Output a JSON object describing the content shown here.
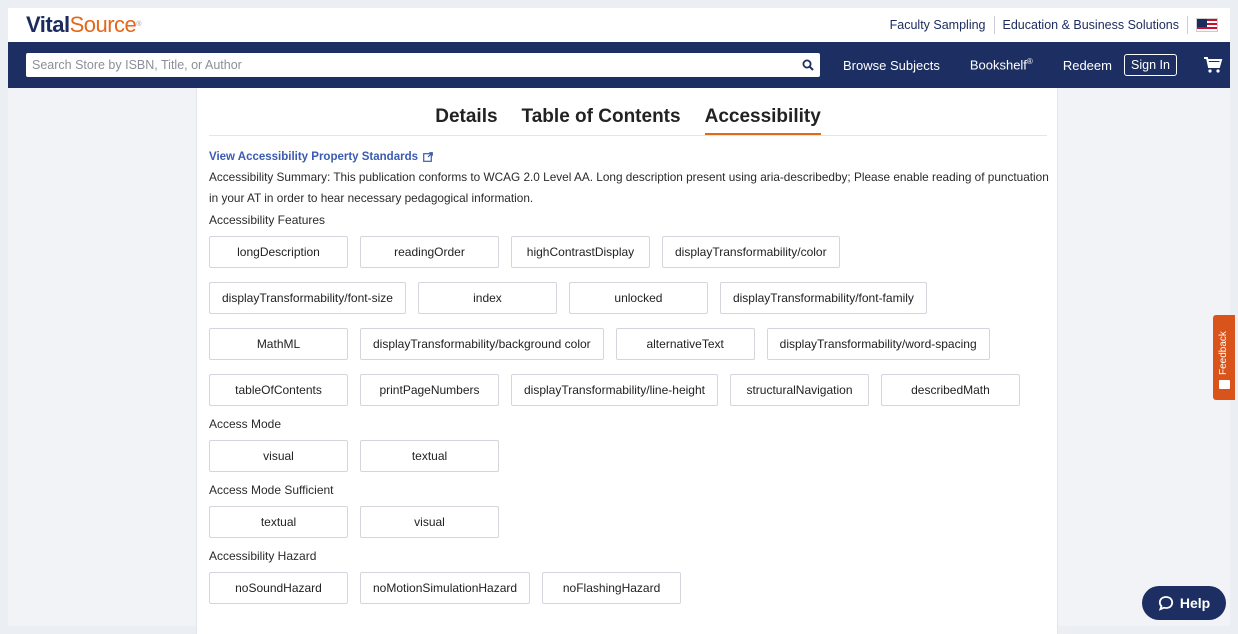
{
  "brand": {
    "logo_part1": "Vital",
    "logo_part2": "Source",
    "logo_mark": "®"
  },
  "topbar": {
    "links": [
      "Faculty Sampling",
      "Education & Business Solutions"
    ],
    "flag_icon": "us-flag-icon"
  },
  "navbar": {
    "search_placeholder": "Search Store by ISBN, Title, or Author",
    "search_value": "",
    "browse_label": "Browse Subjects",
    "bookshelf_label": "Bookshelf",
    "bookshelf_mark": "®",
    "redeem_label": "Redeem",
    "signin_label": "Sign In",
    "cart_icon": "cart-icon"
  },
  "tabs": [
    {
      "label": "Details",
      "active": false
    },
    {
      "label": "Table of Contents",
      "active": false
    },
    {
      "label": "Accessibility",
      "active": true
    }
  ],
  "accessibility": {
    "standards_link": "View Accessibility Property Standards",
    "summary": "Accessibility Summary: This publication conforms to WCAG 2.0 Level AA. Long description present using aria-describedby; Please enable reading of punctuation in your AT in order to hear necessary pedagogical information.",
    "sections": [
      {
        "title": "Accessibility Features",
        "chips": [
          "longDescription",
          "readingOrder",
          "highContrastDisplay",
          "displayTransformability/color",
          "displayTransformability/font-size",
          "index",
          "unlocked",
          "displayTransformability/font-family",
          "MathML",
          "displayTransformability/background color",
          "alternativeText",
          "displayTransformability/word-spacing",
          "tableOfContents",
          "printPageNumbers",
          "displayTransformability/line-height",
          "structuralNavigation",
          "describedMath"
        ]
      },
      {
        "title": "Access Mode",
        "chips": [
          "visual",
          "textual"
        ]
      },
      {
        "title": "Access Mode Sufficient",
        "chips": [
          "textual",
          "visual"
        ]
      },
      {
        "title": "Accessibility Hazard",
        "chips": [
          "noSoundHazard",
          "noMotionSimulationHazard",
          "noFlashingHazard"
        ]
      }
    ]
  },
  "feedback": {
    "label": "Feedback"
  },
  "help": {
    "label": "Help"
  },
  "colors": {
    "navy": "#1d2f62",
    "accent": "#e5671a",
    "link": "#3a5bb0"
  }
}
